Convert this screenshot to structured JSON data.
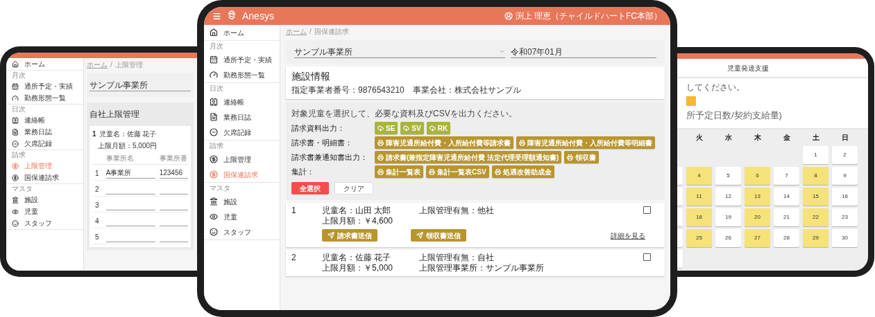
{
  "left_tablet": {
    "sidebar": [
      {
        "items": [
          {
            "label": "ホーム",
            "selected": false
          }
        ]
      },
      {
        "heading": "月次",
        "items": [
          {
            "label": "通所予定・実績",
            "selected": false
          },
          {
            "label": "勤務形態一覧",
            "selected": false
          }
        ]
      },
      {
        "heading": "日次",
        "items": [
          {
            "label": "連絡帳",
            "selected": false
          },
          {
            "label": "業務日誌",
            "selected": false
          },
          {
            "label": "欠席記録",
            "selected": false
          }
        ]
      },
      {
        "heading": "請求",
        "items": [
          {
            "label": "上限管理",
            "selected": true
          },
          {
            "label": "国保連請求",
            "selected": false
          }
        ]
      },
      {
        "heading": "マスタ",
        "items": [
          {
            "label": "施設",
            "selected": false
          },
          {
            "label": "児童",
            "selected": false
          },
          {
            "label": "スタッフ",
            "selected": false
          }
        ]
      }
    ],
    "breadcrumb": {
      "items": [
        "ホーム",
        "上限管理"
      ],
      "separator": "/"
    },
    "office_select": "サンプル事業所",
    "heading": "自社上限管理",
    "card": {
      "number": "1",
      "child_name": "児童名：佐藤 花子",
      "limit": "上限月額：5,000円"
    },
    "table": {
      "columns": [
        "事業所名",
        "事業所番"
      ],
      "rows": [
        {
          "index": "1",
          "name": "A事業所",
          "number": "123456"
        },
        {
          "index": "2"
        },
        {
          "index": "3"
        },
        {
          "index": "4"
        },
        {
          "index": "5"
        }
      ]
    }
  },
  "center_tablet": {
    "app_name": "Anesys",
    "user": "渕上 理恵（チャイルドハートFC本部）",
    "sidebar": [
      {
        "items": [
          {
            "label": "ホーム",
            "selected": false
          }
        ]
      },
      {
        "heading": "月次",
        "items": [
          {
            "label": "通所予定・実績",
            "selected": false
          },
          {
            "label": "勤務形態一覧",
            "selected": false
          }
        ]
      },
      {
        "heading": "日次",
        "items": [
          {
            "label": "連絡帳",
            "selected": false
          },
          {
            "label": "業務日誌",
            "selected": false
          },
          {
            "label": "欠席記録",
            "selected": false
          }
        ]
      },
      {
        "heading": "請求",
        "items": [
          {
            "label": "上限管理",
            "selected": false
          },
          {
            "label": "国保連請求",
            "selected": true
          }
        ]
      },
      {
        "heading": "マスタ",
        "items": [
          {
            "label": "施設",
            "selected": false
          },
          {
            "label": "児童",
            "selected": false
          },
          {
            "label": "スタッフ",
            "selected": false
          }
        ]
      }
    ],
    "breadcrumb": {
      "items": [
        "ホーム",
        "国保連請求"
      ],
      "separator": "/"
    },
    "filters": {
      "office": "サンプル事業所",
      "month": "令和07年01月"
    },
    "facility": {
      "title": "施設情報",
      "details": "指定事業者番号：9876543210　事業会社：株式会社サンプル"
    },
    "instruction": "対象児童を選択して、必要な資料及びCSVを出力ください。",
    "output_rows": [
      {
        "label": "請求資料出力：",
        "buttons": [
          {
            "kind": "download",
            "label": "SE"
          },
          {
            "kind": "download",
            "label": "SV"
          },
          {
            "kind": "download",
            "label": "RK"
          }
        ]
      },
      {
        "label": "請求書・明細書：",
        "buttons": [
          {
            "kind": "print",
            "label": "障害児通所給付費・入所給付費等請求書"
          },
          {
            "kind": "print",
            "label": "障害児通所給付費・入所給付費等明細書"
          }
        ]
      },
      {
        "label": "請求書兼通知書出力：",
        "buttons": [
          {
            "kind": "print",
            "label": "請求書(兼指定障害児通所給付費 法定代理受理額通知書)"
          },
          {
            "kind": "print",
            "label": "領収書"
          }
        ]
      },
      {
        "label": "集計：",
        "buttons": [
          {
            "kind": "print",
            "label": "集計一覧表"
          },
          {
            "kind": "print",
            "label": "集計一覧表CSV"
          },
          {
            "kind": "print",
            "label": "処遇改善助成金"
          }
        ]
      }
    ],
    "select_all": "全選択",
    "clear": "クリア",
    "children": [
      {
        "number": "1",
        "name": "児童名：山田 太郎",
        "limit": "上限月額：￥4,600",
        "management": "上限管理有無：他社",
        "checked": false,
        "actions": [
          "請求書送信",
          "領収書送信"
        ],
        "details_link": "詳細を見る"
      },
      {
        "number": "2",
        "name": "児童名：佐藤 花子",
        "limit": "上限月額：￥5,000",
        "management": "上限管理有無：自社",
        "office": "上限管理事業所：サンプル事業所",
        "checked": false
      }
    ]
  },
  "right_tablet": {
    "service": "児童発達支援",
    "hint": "してください。",
    "title": "所予定日数/契約支給量)",
    "weekdays": [
      "火",
      "水",
      "木",
      "金",
      "土",
      "日"
    ],
    "weeks": [
      {
        "cut_cell": false,
        "days": [
          {
            "kind": "blank"
          },
          {
            "kind": "blank"
          },
          {
            "kind": "blank"
          },
          {
            "kind": "blank"
          },
          {
            "kind": "day",
            "label": "1",
            "selected": false
          },
          {
            "kind": "day",
            "label": "2",
            "selected": false
          }
        ]
      },
      {
        "cut_cell": true,
        "days": [
          {
            "kind": "day",
            "label": "4",
            "selected": true
          },
          {
            "kind": "day",
            "label": "5",
            "selected": false
          },
          {
            "kind": "day",
            "label": "6",
            "selected": true
          },
          {
            "kind": "day",
            "label": "7",
            "selected": false
          },
          {
            "kind": "day",
            "label": "8",
            "selected": true
          },
          {
            "kind": "day",
            "label": "9",
            "selected": false
          }
        ]
      },
      {
        "cut_cell": true,
        "days": [
          {
            "kind": "day",
            "label": "11",
            "selected": true
          },
          {
            "kind": "day",
            "label": "12",
            "selected": false
          },
          {
            "kind": "day",
            "label": "13",
            "selected": true
          },
          {
            "kind": "day",
            "label": "14",
            "selected": false
          },
          {
            "kind": "day",
            "label": "15",
            "selected": true
          },
          {
            "kind": "day",
            "label": "16",
            "selected": false
          }
        ]
      },
      {
        "cut_cell": true,
        "days": [
          {
            "kind": "day",
            "label": "18",
            "selected": true
          },
          {
            "kind": "day",
            "label": "19",
            "selected": false
          },
          {
            "kind": "day",
            "label": "20",
            "selected": true
          },
          {
            "kind": "day",
            "label": "21",
            "selected": false
          },
          {
            "kind": "day",
            "label": "22",
            "selected": true
          },
          {
            "kind": "day",
            "label": "23",
            "selected": false
          }
        ]
      },
      {
        "cut_cell": true,
        "days": [
          {
            "kind": "day",
            "label": "25",
            "selected": true
          },
          {
            "kind": "day",
            "label": "26",
            "selected": false
          },
          {
            "kind": "day",
            "label": "27",
            "selected": true
          },
          {
            "kind": "day",
            "label": "28",
            "selected": false
          },
          {
            "kind": "day",
            "label": "29",
            "selected": true
          },
          {
            "kind": "day",
            "label": "30",
            "selected": false
          }
        ]
      },
      {
        "cut_cell": true
      }
    ]
  }
}
